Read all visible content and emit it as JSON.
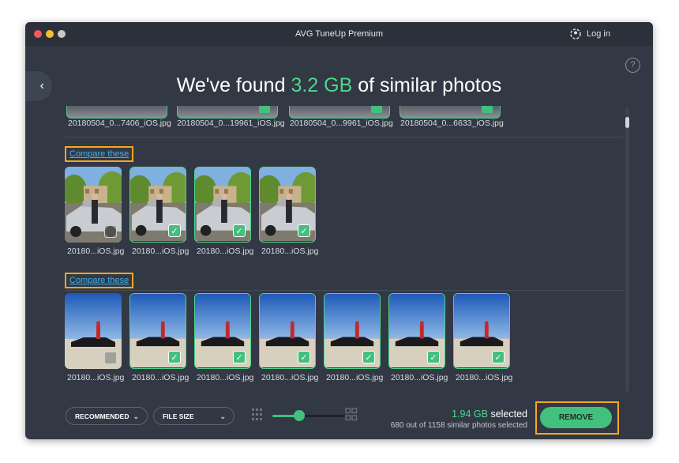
{
  "window": {
    "title": "AVG TuneUp Premium",
    "login_label": "Log in",
    "help_label": "?"
  },
  "headline": {
    "before": "We've found ",
    "amount": "3.2 GB",
    "after": " of similar photos"
  },
  "groups": {
    "top_partial": {
      "files": [
        "20180504_0...7406_iOS.jpg",
        "20180504_0...19961_iOS.jpg",
        "20180504_0...9961_iOS.jpg",
        "20180504_0...6633_iOS.jpg"
      ]
    },
    "group1": {
      "compare_label": "Compare these",
      "photos": [
        {
          "name": "20180...iOS.jpg",
          "selected": false
        },
        {
          "name": "20180...iOS.jpg",
          "selected": true
        },
        {
          "name": "20180...iOS.jpg",
          "selected": true
        },
        {
          "name": "20180...iOS.jpg",
          "selected": true
        }
      ]
    },
    "group2": {
      "compare_label": "Compare these",
      "photos": [
        {
          "name": "20180...iOS.jpg",
          "selected": false
        },
        {
          "name": "20180...iOS.jpg",
          "selected": true
        },
        {
          "name": "20180...iOS.jpg",
          "selected": true
        },
        {
          "name": "20180...iOS.jpg",
          "selected": true
        },
        {
          "name": "20180...iOS.jpg",
          "selected": true
        },
        {
          "name": "20180...iOS.jpg",
          "selected": true
        },
        {
          "name": "20180...iOS.jpg",
          "selected": true
        }
      ]
    }
  },
  "toolbar": {
    "sort_label": "RECOMMENDED",
    "filter_label": "FILE SIZE",
    "zoom_level": 0.37,
    "selected_size": "1.94 GB",
    "selected_word": " selected",
    "selected_count": "680 out of 1158 similar photos selected",
    "remove_label": "REMOVE"
  },
  "colors": {
    "accent": "#42c07e",
    "highlight": "#4fd68d",
    "link": "#3fb2f0",
    "annotation": "#f5a91c",
    "background": "#323844"
  },
  "icons": [
    "back-chevron-icon",
    "help-icon",
    "login-icon",
    "check-icon",
    "chevron-down-icon",
    "small-grid-icon",
    "large-grid-icon"
  ]
}
